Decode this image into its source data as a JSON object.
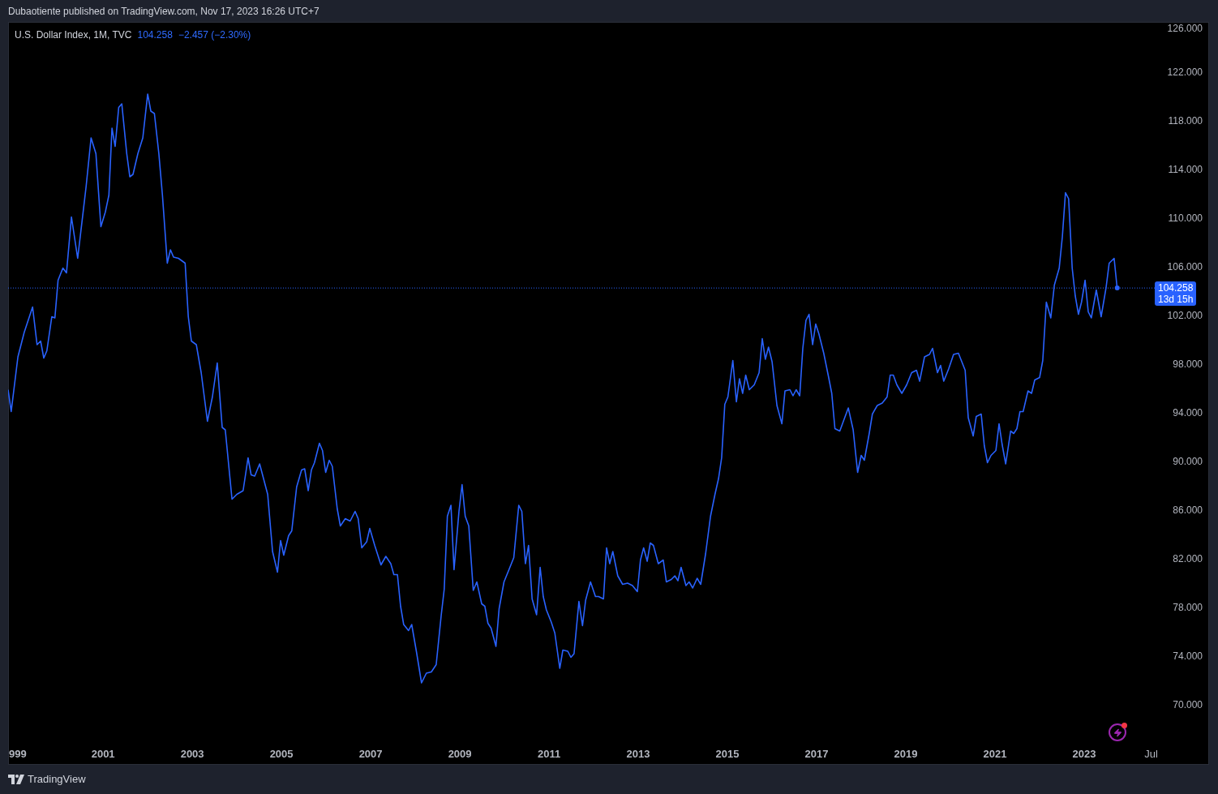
{
  "header": {
    "text": "Dubaotiente published on TradingView.com, Nov 17, 2023 16:26 UTC+7"
  },
  "legend": {
    "symbol": "U.S. Dollar Index, 1M, TVC",
    "price": "104.258",
    "change": "−2.457 (−2.30%)"
  },
  "price_label": {
    "price": "104.258",
    "countdown": "13d 15h"
  },
  "cut_tick_label": "999",
  "chart_data": {
    "type": "line",
    "xlim": [
      1998.87,
      2025.8
    ],
    "ylim": [
      65.07,
      126.13
    ],
    "ref_lines": [
      {
        "axis": "y",
        "value": 104.258
      }
    ],
    "xticks": [
      {
        "value": 2001,
        "label": "2001"
      },
      {
        "value": 2003,
        "label": "2003"
      },
      {
        "value": 2005,
        "label": "2005"
      },
      {
        "value": 2007,
        "label": "2007"
      },
      {
        "value": 2009,
        "label": "2009"
      },
      {
        "value": 2011,
        "label": "2011"
      },
      {
        "value": 2013,
        "label": "2013"
      },
      {
        "value": 2015,
        "label": "2015"
      },
      {
        "value": 2017,
        "label": "2017"
      },
      {
        "value": 2019,
        "label": "2019"
      },
      {
        "value": 2021,
        "label": "2021"
      },
      {
        "value": 2023,
        "label": "2023"
      },
      {
        "value": 2024.5,
        "label": "Jul"
      }
    ],
    "yticks": [
      {
        "value": 70,
        "label": "70.000"
      },
      {
        "value": 74,
        "label": "74.000"
      },
      {
        "value": 78,
        "label": "78.000"
      },
      {
        "value": 82,
        "label": "82.000"
      },
      {
        "value": 86,
        "label": "86.000"
      },
      {
        "value": 90,
        "label": "90.000"
      },
      {
        "value": 94,
        "label": "94.000"
      },
      {
        "value": 98,
        "label": "98.000"
      },
      {
        "value": 102,
        "label": "102.000"
      },
      {
        "value": 106,
        "label": "106.000"
      },
      {
        "value": 110,
        "label": "110.000"
      },
      {
        "value": 114,
        "label": "114.000"
      },
      {
        "value": 118,
        "label": "118.000"
      },
      {
        "value": 122,
        "label": "122.000"
      },
      {
        "value": 126,
        "label": "126.000"
      }
    ],
    "x": [
      1998.87,
      1998.94,
      1999.09,
      1999.23,
      1999.42,
      1999.52,
      1999.6,
      1999.67,
      1999.74,
      1999.85,
      1999.92,
      1999.99,
      2000.1,
      2000.18,
      2000.29,
      2000.43,
      2000.62,
      2000.73,
      2000.84,
      2000.95,
      2001.05,
      2001.13,
      2001.2,
      2001.27,
      2001.35,
      2001.42,
      2001.53,
      2001.6,
      2001.67,
      2001.78,
      2001.89,
      2002.0,
      2002.07,
      2002.15,
      2002.25,
      2002.33,
      2002.44,
      2002.51,
      2002.58,
      2002.69,
      2002.84,
      2002.91,
      2002.98,
      2003.09,
      2003.2,
      2003.34,
      2003.45,
      2003.56,
      2003.67,
      2003.74,
      2003.89,
      2004.0,
      2004.14,
      2004.25,
      2004.32,
      2004.4,
      2004.51,
      2004.69,
      2004.8,
      2004.91,
      2004.98,
      2005.05,
      2005.16,
      2005.23,
      2005.34,
      2005.45,
      2005.52,
      2005.6,
      2005.67,
      2005.74,
      2005.85,
      2005.92,
      2005.99,
      2006.07,
      2006.14,
      2006.25,
      2006.32,
      2006.43,
      2006.54,
      2006.65,
      2006.72,
      2006.8,
      2006.91,
      2006.98,
      2007.09,
      2007.23,
      2007.34,
      2007.45,
      2007.52,
      2007.6,
      2007.67,
      2007.74,
      2007.85,
      2007.92,
      2008.03,
      2008.14,
      2008.25,
      2008.36,
      2008.47,
      2008.58,
      2008.65,
      2008.72,
      2008.8,
      2008.87,
      2008.98,
      2009.05,
      2009.12,
      2009.2,
      2009.3,
      2009.38,
      2009.49,
      2009.56,
      2009.63,
      2009.7,
      2009.81,
      2009.88,
      2009.99,
      2010.1,
      2010.21,
      2010.32,
      2010.39,
      2010.47,
      2010.54,
      2010.62,
      2010.72,
      2010.8,
      2010.87,
      2010.94,
      2011.05,
      2011.13,
      2011.24,
      2011.31,
      2011.42,
      2011.49,
      2011.56,
      2011.67,
      2011.75,
      2011.82,
      2011.93,
      2012.04,
      2012.11,
      2012.22,
      2012.29,
      2012.36,
      2012.43,
      2012.54,
      2012.65,
      2012.76,
      2012.87,
      2012.98,
      2013.05,
      2013.12,
      2013.2,
      2013.27,
      2013.34,
      2013.45,
      2013.56,
      2013.63,
      2013.74,
      2013.82,
      2013.89,
      2013.96,
      2014.07,
      2014.14,
      2014.22,
      2014.32,
      2014.4,
      2014.51,
      2014.62,
      2014.72,
      2014.8,
      2014.87,
      2014.94,
      2015.01,
      2015.12,
      2015.2,
      2015.27,
      2015.34,
      2015.41,
      2015.49,
      2015.6,
      2015.71,
      2015.78,
      2015.85,
      2015.92,
      2016.0,
      2016.11,
      2016.22,
      2016.29,
      2016.4,
      2016.47,
      2016.54,
      2016.62,
      2016.69,
      2016.76,
      2016.83,
      2016.91,
      2016.98,
      2017.05,
      2017.16,
      2017.27,
      2017.34,
      2017.41,
      2017.52,
      2017.6,
      2017.71,
      2017.82,
      2017.92,
      2018.0,
      2018.07,
      2018.18,
      2018.25,
      2018.36,
      2018.47,
      2018.58,
      2018.65,
      2018.72,
      2018.8,
      2018.91,
      2019.02,
      2019.13,
      2019.24,
      2019.31,
      2019.42,
      2019.53,
      2019.6,
      2019.71,
      2019.78,
      2019.85,
      2019.96,
      2020.07,
      2020.18,
      2020.33,
      2020.4,
      2020.51,
      2020.58,
      2020.69,
      2020.76,
      2020.83,
      2020.91,
      2021.02,
      2021.09,
      2021.16,
      2021.24,
      2021.35,
      2021.42,
      2021.49,
      2021.56,
      2021.63,
      2021.74,
      2021.82,
      2021.89,
      2022.0,
      2022.07,
      2022.15,
      2022.25,
      2022.33,
      2022.44,
      2022.51,
      2022.58,
      2022.65,
      2022.73,
      2022.8,
      2022.87,
      2022.94,
      2023.02,
      2023.09,
      2023.16,
      2023.27,
      2023.38,
      2023.49,
      2023.56,
      2023.67,
      2023.74
    ],
    "series": [
      {
        "color": "#2962ff",
        "values": [
          95.9,
          94.1,
          98.6,
          100.6,
          102.7,
          99.6,
          99.9,
          98.5,
          99.1,
          101.9,
          101.8,
          104.9,
          105.9,
          105.5,
          110.1,
          106.7,
          112.6,
          116.6,
          115.3,
          109.3,
          110.5,
          111.9,
          117.4,
          115.9,
          119.1,
          119.4,
          115.3,
          113.4,
          113.6,
          115.3,
          116.6,
          120.2,
          118.8,
          118.6,
          115.3,
          111.9,
          106.3,
          107.4,
          106.8,
          106.7,
          106.3,
          101.9,
          99.9,
          99.6,
          97.3,
          93.3,
          95.3,
          98.1,
          92.8,
          92.6,
          86.9,
          87.3,
          87.6,
          90.3,
          88.9,
          88.8,
          89.8,
          87.3,
          82.6,
          80.9,
          83.5,
          82.3,
          83.9,
          84.3,
          87.9,
          89.3,
          89.4,
          87.6,
          89.3,
          89.9,
          91.5,
          90.9,
          89.1,
          90.1,
          89.6,
          86.1,
          84.7,
          85.3,
          85.1,
          85.9,
          85.3,
          82.9,
          83.4,
          84.5,
          83.1,
          81.5,
          82.2,
          81.6,
          80.7,
          80.7,
          78.1,
          76.6,
          76.1,
          76.6,
          74.3,
          71.8,
          72.6,
          72.7,
          73.3,
          77.3,
          79.5,
          85.5,
          86.4,
          81.1,
          85.9,
          88.1,
          85.5,
          84.7,
          79.4,
          80.1,
          78.3,
          78.1,
          76.7,
          76.3,
          74.8,
          77.9,
          80.1,
          81.1,
          82.1,
          86.4,
          85.9,
          81.6,
          83.1,
          78.7,
          77.4,
          81.3,
          78.9,
          77.8,
          76.8,
          75.9,
          73.0,
          74.5,
          74.4,
          73.9,
          74.2,
          78.5,
          76.5,
          78.6,
          80.1,
          78.9,
          78.9,
          78.7,
          82.9,
          81.6,
          82.6,
          80.6,
          79.9,
          80.0,
          79.8,
          79.3,
          81.9,
          82.9,
          81.8,
          83.3,
          83.1,
          81.6,
          81.9,
          80.1,
          80.3,
          80.6,
          80.2,
          81.3,
          79.8,
          80.1,
          79.6,
          80.4,
          79.9,
          82.4,
          85.5,
          87.3,
          88.6,
          90.3,
          94.7,
          95.3,
          98.3,
          94.9,
          96.8,
          95.6,
          97.1,
          95.9,
          96.3,
          97.3,
          100.1,
          98.4,
          99.4,
          98.2,
          94.6,
          93.1,
          95.8,
          95.9,
          95.4,
          95.9,
          95.4,
          99.3,
          101.6,
          102.1,
          99.6,
          101.3,
          100.5,
          98.9,
          96.9,
          95.6,
          92.7,
          92.5,
          93.3,
          94.4,
          92.6,
          89.1,
          90.5,
          90.1,
          92.3,
          93.9,
          94.6,
          94.8,
          95.3,
          97.1,
          97.1,
          96.3,
          95.6,
          96.3,
          97.3,
          97.5,
          96.6,
          98.6,
          98.8,
          99.3,
          97.3,
          97.9,
          96.6,
          97.6,
          98.8,
          98.9,
          97.5,
          93.6,
          92.1,
          93.7,
          93.9,
          91.3,
          89.9,
          90.5,
          90.9,
          93.1,
          91.4,
          89.8,
          92.5,
          92.3,
          92.7,
          94.1,
          94.1,
          95.8,
          95.6,
          96.7,
          96.9,
          98.3,
          103.1,
          101.8,
          104.5,
          105.9,
          108.5,
          112.1,
          111.6,
          105.9,
          103.6,
          102.1,
          103.1,
          104.9,
          102.3,
          101.8,
          104.1,
          101.9,
          104.3,
          106.3,
          106.7,
          104.2
        ]
      }
    ]
  },
  "footer": {
    "brand": "TradingView"
  }
}
